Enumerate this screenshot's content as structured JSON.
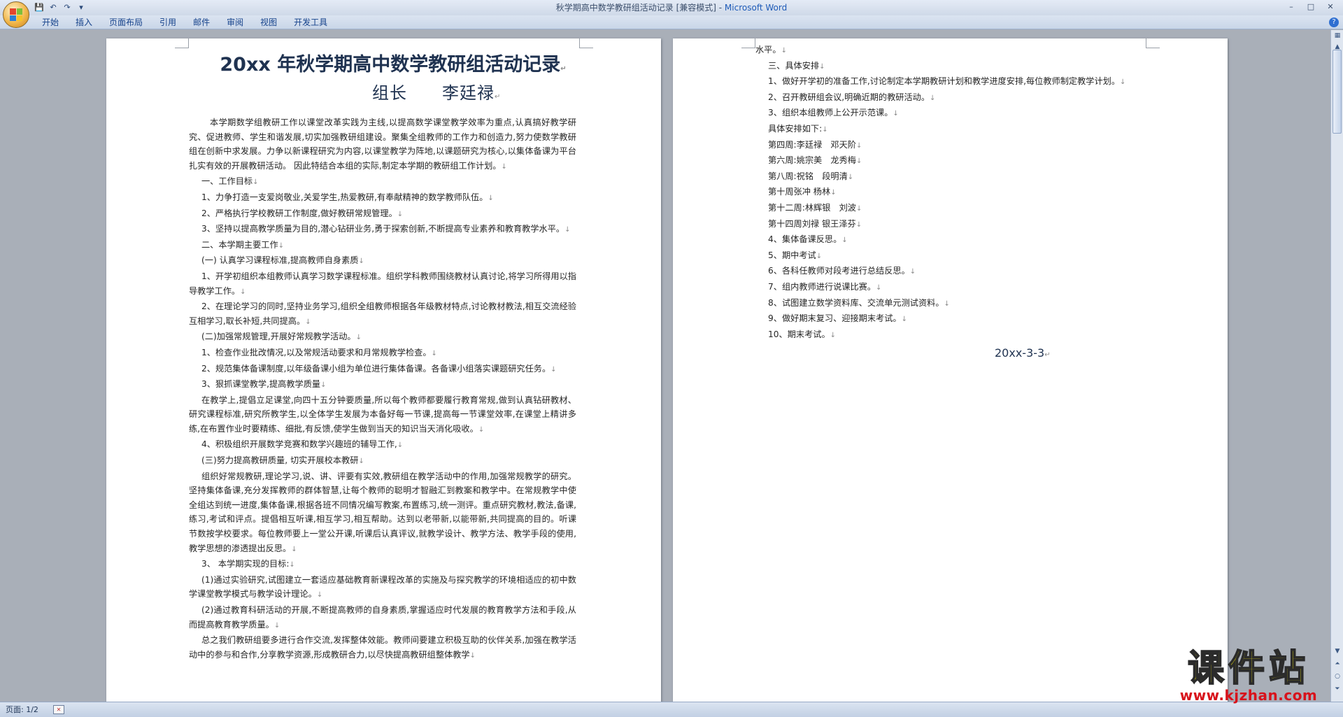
{
  "window": {
    "title": "秋学期高中数学教研组活动记录 [兼容模式] - ",
    "app_name": "Microsoft Word",
    "controls": {
      "minimize": "–",
      "maximize": "□",
      "close": "✕"
    }
  },
  "qat": {
    "save": "💾",
    "undo": "↶",
    "redo": "↷",
    "more": "▾"
  },
  "ribbon": {
    "tabs": [
      "开始",
      "插入",
      "页面布局",
      "引用",
      "邮件",
      "审阅",
      "视图",
      "开发工具"
    ],
    "help": "?"
  },
  "page1": {
    "title": "20xx 年秋学期高中数学教研组活动记录",
    "subtitle": "组长　　李廷禄",
    "paragraphs": [
      "本学期数学组教研工作以课堂改革实践为主线,以提高数学课堂教学效率为重点,认真搞好教学研究、促进教师、学生和谐发展,切实加强教研组建设。聚集全组教师的工作力和创造力,努力使数学教研组在创新中求发展。力争以新课程研究为内容,以课堂教学为阵地,以课题研究为核心,以集体备课为平台扎实有效的开展教研活动。 因此特结合本组的实际,制定本学期的教研组工作计划。",
      "一、工作目标",
      "1、力争打造一支爱岗敬业,关爱学生,热爱教研,有奉献精神的数学教师队伍。",
      "2、严格执行学校教研工作制度,做好教研常规管理。",
      "3、坚持以提高教学质量为目的,潜心钻研业务,勇于探索创新,不断提高专业素养和教育教学水平。",
      "二、本学期主要工作",
      "(一) 认真学习课程标准,提高教师自身素质",
      "1、开学初组织本组教师认真学习数学课程标准。组织学科教师围绕教材认真讨论,将学习所得用以指导教学工作。",
      "2、在理论学习的同时,坚持业务学习,组织全组教师根据各年级教材特点,讨论教材教法,相互交流经验互相学习,取长补短,共同提高。",
      "(二)加强常规管理,开展好常规教学活动。",
      "1、检查作业批改情况,以及常规活动要求和月常规教学检查。",
      "2、规范集体备课制度,以年级备课小组为单位进行集体备课。各备课小组落实课题研究任务。",
      "3、狠抓课堂教学,提高教学质量",
      "在教学上,提倡立足课堂,向四十五分钟要质量,所以每个教师都要履行教育常规,做到认真钻研教材、研究课程标准,研究所教学生,以全体学生发展为本备好每一节课,提高每一节课堂效率,在课堂上精讲多练,在布置作业时要精练、细批,有反馈,使学生做到当天的知识当天消化吸收。",
      "4、积极组织开展数学竞赛和数学兴趣班的辅导工作,",
      "(三)努力提高教研质量, 切实开展校本教研",
      "组织好常规教研,理论学习,说、讲、评要有实效,教研组在教学活动中的作用,加强常规教学的研究。坚持集体备课,充分发挥教师的群体智慧,让每个教师的聪明才智融汇到教案和教学中。在常规教学中使全组达到统一进度,集体备课,根据各班不同情况编写教案,布置练习,统一测评。重点研究教材,教法,备课,练习,考试和评点。提倡相互听课,相互学习,相互帮助。达到以老带新,以能带新,共同提高的目的。听课节数按学校要求。每位教师要上一堂公开课,听课后认真评议,就教学设计、教学方法、教学手段的使用,教学思想的渗透提出反思。",
      "3、 本学期实现的目标:",
      "(1)通过实验研究,试图建立一套适应基础教育新课程改革的实施及与探究教学的环境相适应的初中数学课堂教学模式与教学设计理论。",
      "(2)通过教育科研活动的开展,不断提高教师的自身素质,掌握适应时代发展的教育教学方法和手段,从而提高教育教学质量。",
      "总之我们教研组要多进行合作交流,发挥整体效能。教师间要建立积极互助的伙伴关系,加强在教学活动中的参与和合作,分享教学资源,形成教研合力,以尽快提高教研组整体教学"
    ]
  },
  "page2": {
    "paragraphs": [
      "水平。",
      "三、具体安排",
      "1、做好开学初的准备工作,讨论制定本学期教研计划和教学进度安排,每位教师制定教学计划。",
      "2、召开教研组会议,明确近期的教研活动。",
      "3、组织本组教师上公开示范课。",
      "具体安排如下:",
      "第四周:李廷禄　邓天阶",
      "第六周:姚宗美　龙秀梅",
      "第八周:祝铭　段明清",
      "第十周张冲 杨林",
      "第十二周:林辉银　刘波",
      "第十四周刘禄 银王泽芬",
      "4、集体备课反思。",
      "5、期中考试",
      "6、各科任教师对段考进行总结反思。",
      "7、组内教师进行说课比赛。",
      "8、试图建立数学资料库、交流单元测试资料。",
      "9、做好期末复习、迎接期末考试。",
      "10、期末考试。"
    ],
    "date": "20xx-3-3"
  },
  "status": {
    "page": "页面: 1/2"
  },
  "watermark": {
    "name": "课件站",
    "url": "www.kjzhan.com"
  }
}
